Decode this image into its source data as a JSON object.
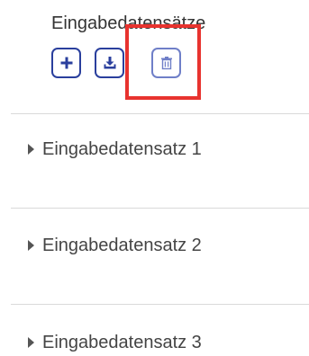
{
  "panel": {
    "title": "Eingabedatensätze",
    "toolbar": {
      "add_icon": "plus-icon",
      "download_icon": "download-icon",
      "delete_icon": "trash-icon",
      "accent_color": "#2a3f9d"
    }
  },
  "items": [
    {
      "label": "Eingabedatensatz 1"
    },
    {
      "label": "Eingabedatensatz 2"
    },
    {
      "label": "Eingabedatensatz 3"
    }
  ],
  "highlight_color": "#e8332f"
}
